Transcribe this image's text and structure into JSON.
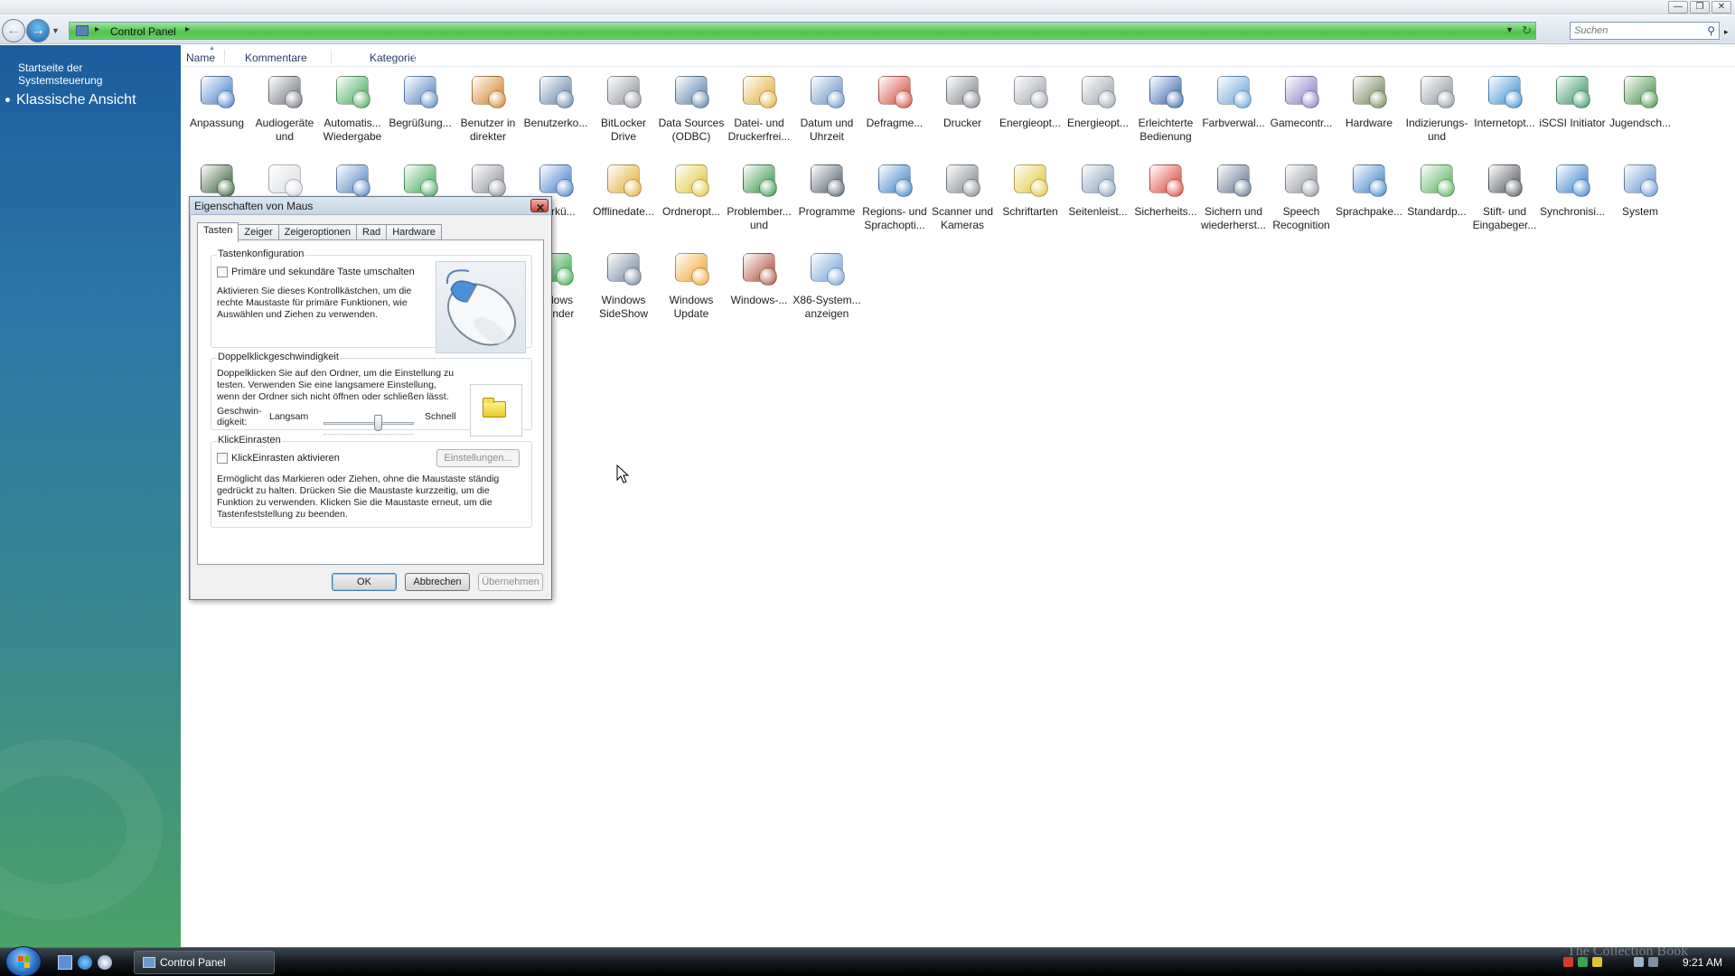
{
  "window": {
    "buttons": {
      "minimize": "—",
      "restore": "❐",
      "close": "✕"
    }
  },
  "navbar": {
    "address": "Control Panel",
    "search_placeholder": "Suchen"
  },
  "left_pane": {
    "home_link": "Startseite der\nSystemsteuerung",
    "classic_view": "Klassische Ansicht"
  },
  "columns": [
    "Name",
    "Kommentare",
    "Kategorie"
  ],
  "items": [
    {
      "label": "Anpassung",
      "icon": "personalization-icon",
      "color": "#3a78c8"
    },
    {
      "label": "Audiogeräte\nund",
      "icon": "speaker-icon",
      "color": "#6a6f77"
    },
    {
      "label": "Automatis...\nWiedergabe",
      "icon": "autoplay-icon",
      "color": "#3aa651"
    },
    {
      "label": "Begrüßung...",
      "icon": "welcome-center-icon",
      "color": "#4a7fc1"
    },
    {
      "label": "Benutzer in\ndirekter",
      "icon": "parental-user-icon",
      "color": "#d07a1a"
    },
    {
      "label": "Benutzerko...",
      "icon": "user-accounts-icon",
      "color": "#5a7fa8"
    },
    {
      "label": "BitLocker\nDrive",
      "icon": "bitlocker-icon",
      "color": "#8a8f96"
    },
    {
      "label": "Data Sources\n(ODBC)",
      "icon": "odbc-icon",
      "color": "#4f79a6"
    },
    {
      "label": "Datei- und\nDruckerfrei...",
      "icon": "file-sharing-icon",
      "color": "#e2a92a"
    },
    {
      "label": "Datum und\nUhrzeit",
      "icon": "clock-icon",
      "color": "#5d8fc4"
    },
    {
      "label": "Defragme...",
      "icon": "defrag-icon",
      "color": "#d2402f"
    },
    {
      "label": "Drucker",
      "icon": "printer-icon",
      "color": "#7b8087"
    },
    {
      "label": "Energieopt...",
      "icon": "power-options-icon",
      "color": "#9aa1aa"
    },
    {
      "label": "Energieopt...",
      "icon": "power-options-icon",
      "color": "#9aa1aa"
    },
    {
      "label": "Erleichterte\nBedienung",
      "icon": "ease-of-access-icon",
      "color": "#2a5fa8"
    },
    {
      "label": "Farbverwal...",
      "icon": "color-management-icon",
      "color": "#5fa0d8"
    },
    {
      "label": "Gamecontr...",
      "icon": "gamepad-icon",
      "color": "#7f76c2"
    },
    {
      "label": "Hardware",
      "icon": "hardware-icon",
      "color": "#6a7d4a"
    },
    {
      "label": "Indizierungs-\nund",
      "icon": "indexing-icon",
      "color": "#8a9098"
    },
    {
      "label": "Internetopt...",
      "icon": "internet-options-icon",
      "color": "#2f8bd0"
    },
    {
      "label": "iSCSI Initiator",
      "icon": "iscsi-icon",
      "color": "#2a8f5a"
    },
    {
      "label": "Jugendsch...",
      "icon": "parental-controls-icon",
      "color": "#3c8a3c"
    },
    {
      "label": "",
      "icon": "performance-monitor-icon",
      "color": "#2d5a2d"
    },
    {
      "label": "",
      "icon": "mouse-icon",
      "color": "#d8dce0"
    },
    {
      "label": "",
      "icon": "network-icon",
      "color": "#4a7fc1"
    },
    {
      "label": "",
      "icon": "network-map-icon",
      "color": "#3aa651"
    },
    {
      "label": "",
      "icon": "programs-list-icon",
      "color": "#8a9098"
    },
    {
      "label": "...erkü...",
      "icon": "network-connections-icon",
      "color": "#3a78c8"
    },
    {
      "label": "Offlinedate...",
      "icon": "offline-files-icon",
      "color": "#e2a92a"
    },
    {
      "label": "Ordneropt...",
      "icon": "folder-options-icon",
      "color": "#e2c22a"
    },
    {
      "label": "Problember...\nund",
      "icon": "problem-reports-icon",
      "color": "#2a8f3a"
    },
    {
      "label": "Programme",
      "icon": "programs-icon",
      "color": "#4a5866"
    },
    {
      "label": "Regions- und\nSprachopti...",
      "icon": "regional-icon",
      "color": "#2f7ec8"
    },
    {
      "label": "Scanner und\nKameras",
      "icon": "scanner-icon",
      "color": "#7b8087"
    },
    {
      "label": "Schriftarten",
      "icon": "fonts-folder-icon",
      "color": "#e2c22a"
    },
    {
      "label": "Seitenleist...",
      "icon": "sidebar-gear-icon",
      "color": "#7f9ab8"
    },
    {
      "label": "Sicherheits...",
      "icon": "security-shield-icon",
      "color": "#d93a2a"
    },
    {
      "label": "Sichern und\nwiederherst...",
      "icon": "backup-icon",
      "color": "#5a6e8a"
    },
    {
      "label": "Speech\nRecognition",
      "icon": "microphone-icon",
      "color": "#8a9098"
    },
    {
      "label": "Sprachpake...",
      "icon": "language-pack-icon",
      "color": "#2f7ec8"
    },
    {
      "label": "Standardp...",
      "icon": "default-programs-icon",
      "color": "#4caf50"
    },
    {
      "label": "Stift- und\nEingabeger...",
      "icon": "pen-icon",
      "color": "#4a4f57"
    },
    {
      "label": "Synchronisi...",
      "icon": "sync-icon",
      "color": "#2f7ec8"
    },
    {
      "label": "System",
      "icon": "system-icon",
      "color": "#5a8fd0"
    },
    {
      "label": "...dows\n...ender",
      "icon": "windows-defender-icon",
      "color": "#2aa840"
    },
    {
      "label": "Windows\nSideShow",
      "icon": "sideshow-icon",
      "color": "#6a7f98"
    },
    {
      "label": "Windows\nUpdate",
      "icon": "windows-update-icon",
      "color": "#f0a020"
    },
    {
      "label": "Windows-...",
      "icon": "firewall-icon",
      "color": "#a8442a"
    },
    {
      "label": "X86-System...\nanzeigen",
      "icon": "x86-system-icon",
      "color": "#6a9ed8"
    }
  ],
  "dialog": {
    "title": "Eigenschaften von Maus",
    "tabs": [
      "Tasten",
      "Zeiger",
      "Zeigeroptionen",
      "Rad",
      "Hardware"
    ],
    "group1": {
      "title": "Tastenkonfiguration",
      "checkbox": "Primäre und sekundäre Taste umschalten",
      "desc": "Aktivieren Sie dieses Kontrollkästchen, um die\nrechte Maustaste für primäre Funktionen, wie\nAuswählen und Ziehen zu verwenden."
    },
    "group2": {
      "title": "Doppelklickgeschwindigkeit",
      "desc": "Doppelklicken Sie auf den Ordner, um die Einstellung zu\ntesten. Verwenden Sie eine langsamere Einstellung,\nwenn der Ordner sich nicht öffnen oder schließen lässt.",
      "speed_label": "Geschwin-\ndigkeit:",
      "slow": "Langsam",
      "fast": "Schnell"
    },
    "group3": {
      "title": "KlickEinrasten",
      "checkbox": "KlickEinrasten aktivieren",
      "settings_btn": "Einstellungen...",
      "desc": "Ermöglicht das Markieren oder Ziehen, ohne die Maustaste ständig\ngedrückt zu halten. Drücken Sie die Maustaste kurzzeitig, um die\nFunktion zu verwenden. Klicken Sie die Maustaste erneut, um die\nTastenfeststellung zu beenden."
    },
    "buttons": {
      "ok": "OK",
      "cancel": "Abbrechen",
      "apply": "Übernehmen"
    }
  },
  "taskbar": {
    "task_label": "Control Panel",
    "clock": "9:21 AM",
    "watermark": "The Collection Book"
  }
}
